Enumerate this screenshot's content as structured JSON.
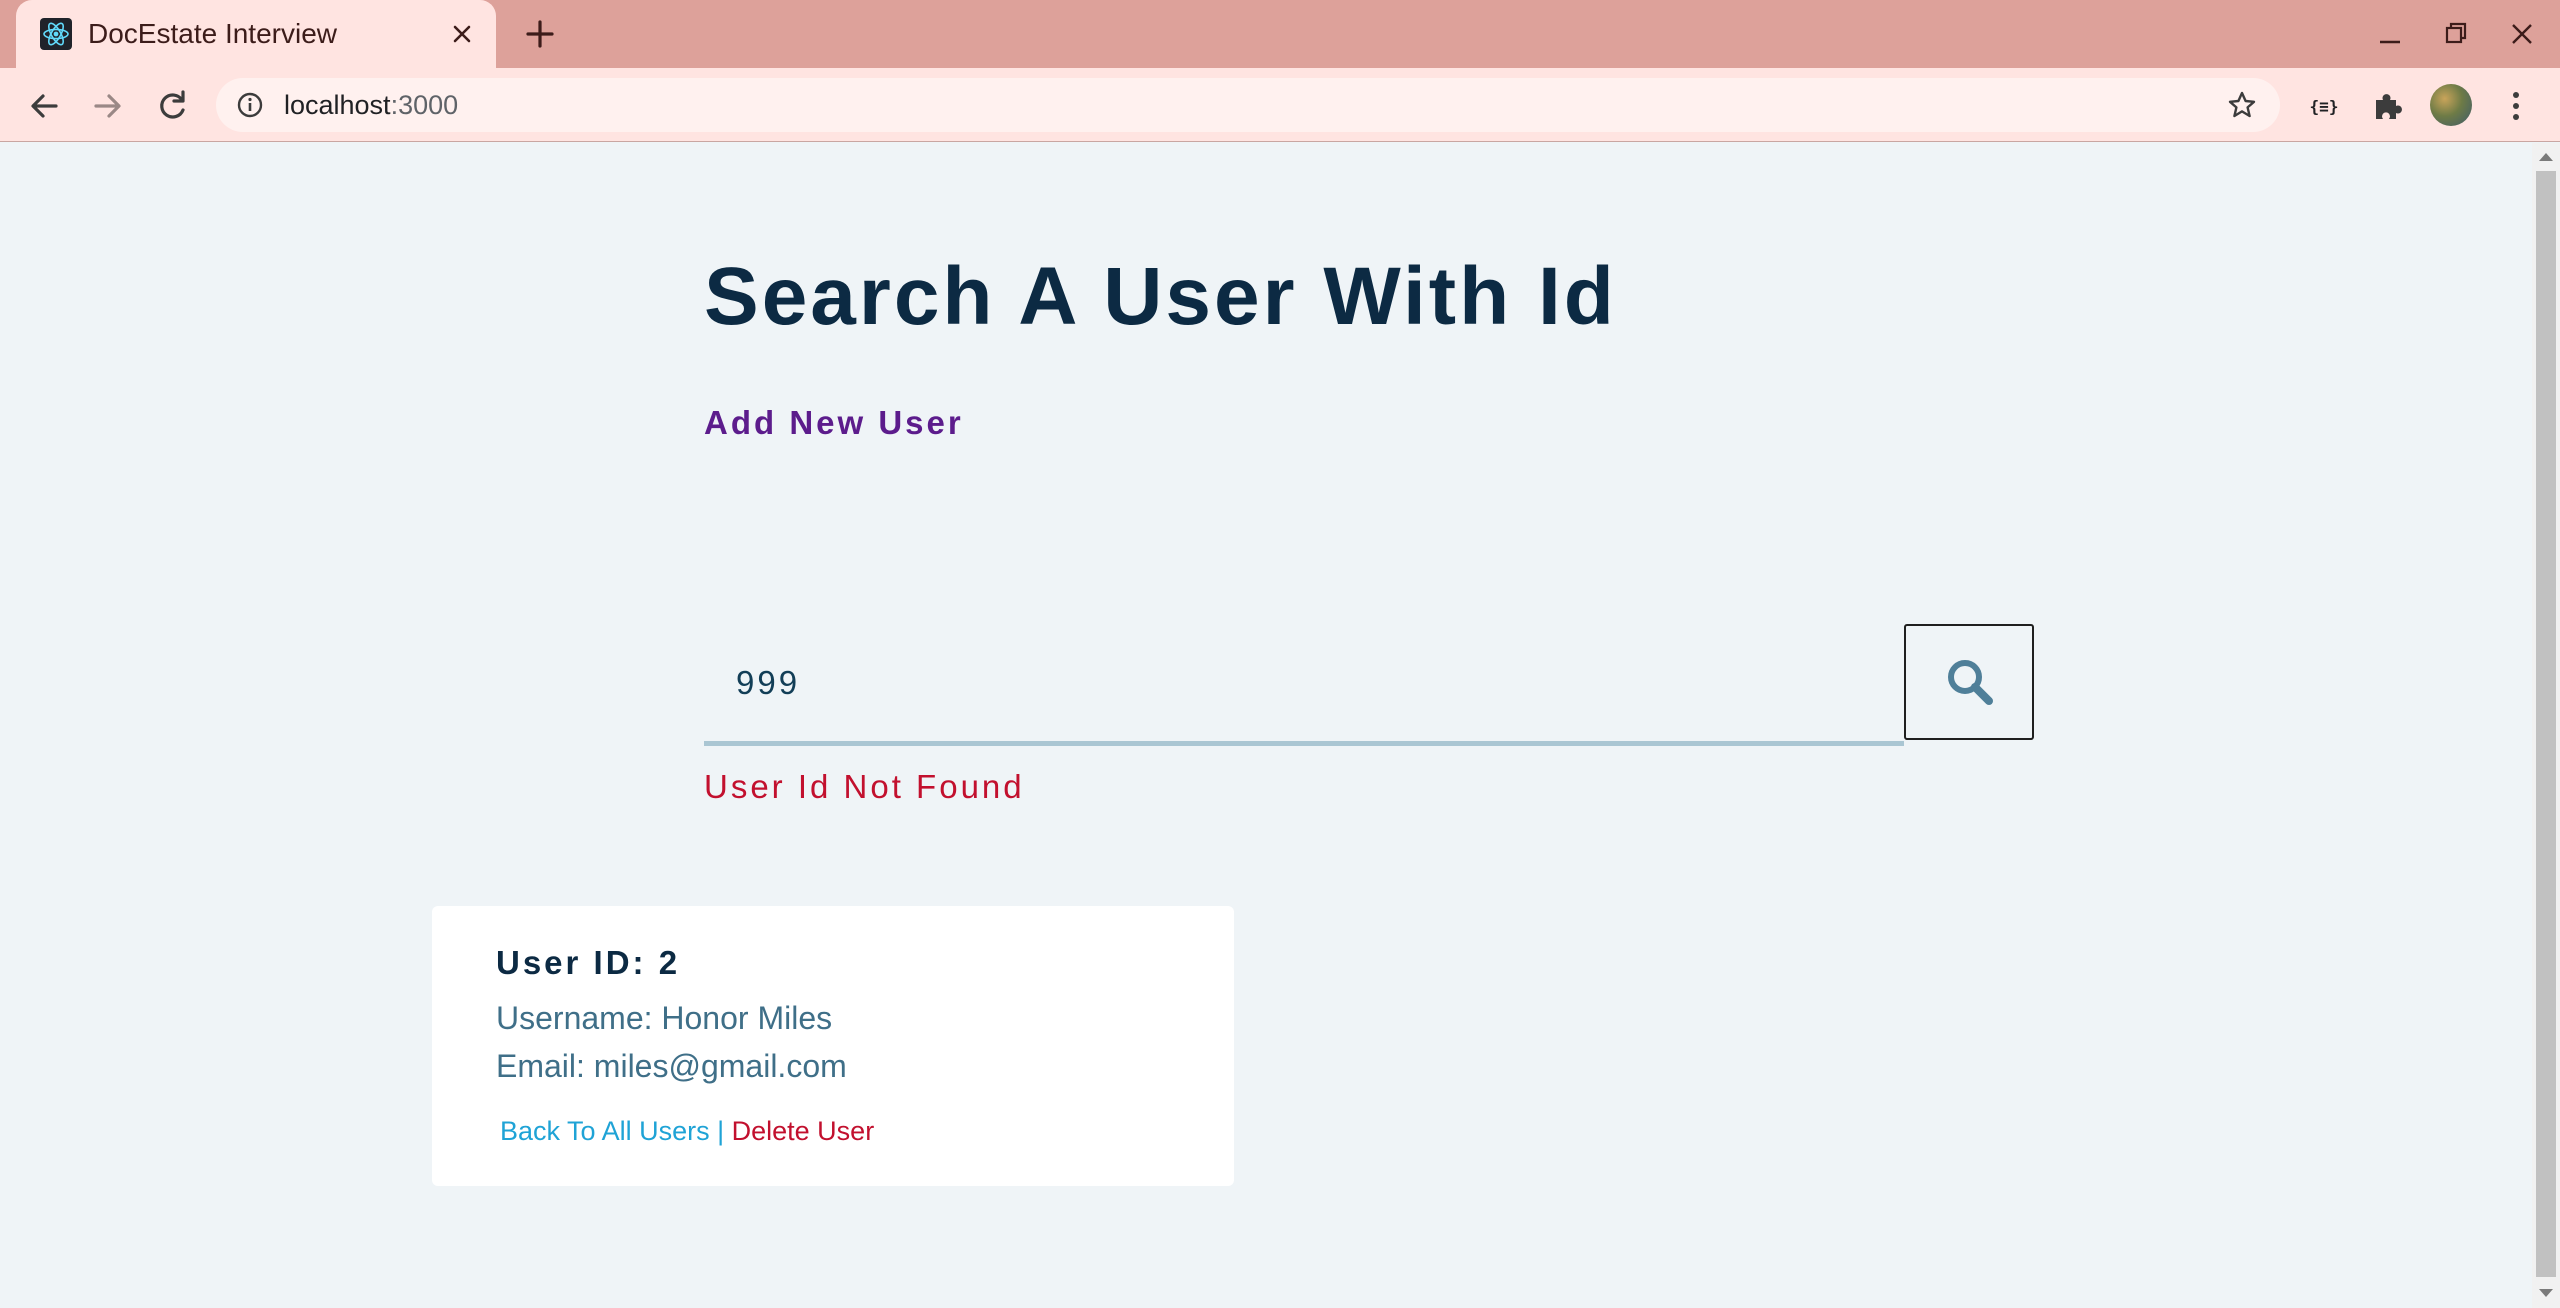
{
  "browser": {
    "tab_title": "DocEstate Interview",
    "url_host": "localhost",
    "url_port": ":3000"
  },
  "page": {
    "title": "Search A User With Id",
    "add_user_link": "Add New User",
    "search": {
      "value": "999",
      "placeholder": ""
    },
    "error_message": "User Id Not Found"
  },
  "user_card": {
    "id_label": "User ID: 2",
    "username": "Username: Honor Miles",
    "email": "Email: miles@gmail.com",
    "back_link": "Back To All Users",
    "separator": " | ",
    "delete_link": "Delete User"
  },
  "colors": {
    "tabstrip": "#dda19a",
    "toolbar": "#ffe4e1",
    "page_bg": "#eff4f7",
    "title": "#0c2a43",
    "add_link": "#5c1c8c",
    "error": "#c2102e",
    "back_link": "#1fa3d6"
  },
  "icons": {
    "favicon": "react-atom-icon",
    "tab_close": "close-icon",
    "new_tab": "plus-icon",
    "back": "arrow-left-icon",
    "forward": "arrow-right-icon",
    "reload": "reload-icon",
    "site_info": "info-icon",
    "bookmark": "star-icon",
    "json_viewer": "braces-icon",
    "extensions": "puzzle-icon",
    "menu": "kebab-menu-icon",
    "search": "magnifier-icon"
  }
}
